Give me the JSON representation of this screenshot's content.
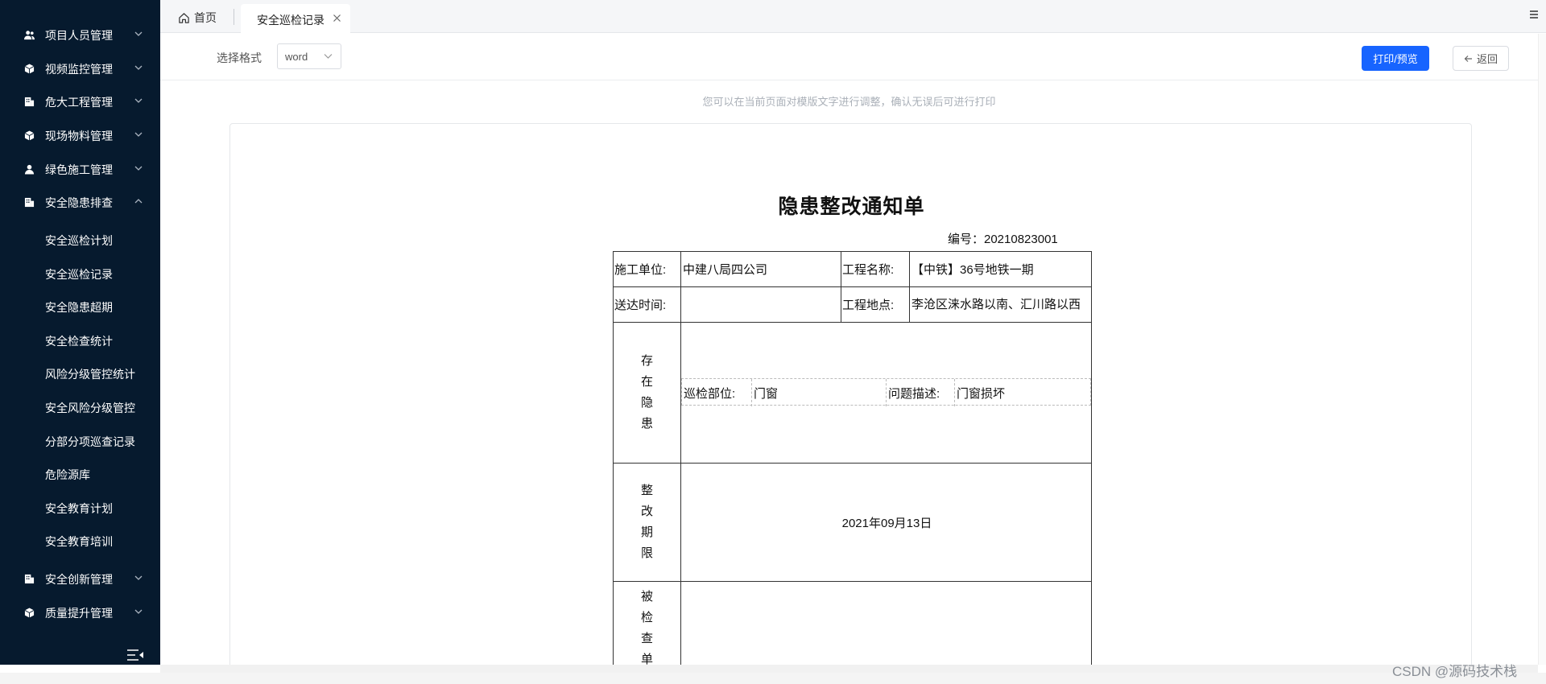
{
  "sidebar": {
    "menus": [
      {
        "label": "项目人员管理",
        "icon": "users-icon",
        "expanded": false
      },
      {
        "label": "视频监控管理",
        "icon": "cube-icon",
        "expanded": false
      },
      {
        "label": "危大工程管理",
        "icon": "building-icon",
        "expanded": false
      },
      {
        "label": "现场物料管理",
        "icon": "cube-icon",
        "expanded": false
      },
      {
        "label": "绿色施工管理",
        "icon": "user-icon",
        "expanded": false
      },
      {
        "label": "安全隐患排查",
        "icon": "building-icon",
        "expanded": true
      },
      {
        "label": "安全创新管理",
        "icon": "building-icon",
        "expanded": false
      },
      {
        "label": "质量提升管理",
        "icon": "cube-icon",
        "expanded": false
      }
    ],
    "submenu": [
      "安全巡检计划",
      "安全巡检记录",
      "安全隐患超期",
      "安全检查统计",
      "风险分级管控统计",
      "安全风险分级管控",
      "分部分项巡查记录",
      "危险源库",
      "安全教育计划",
      "安全教育培训"
    ]
  },
  "tabs": {
    "home": "首页",
    "active": "安全巡检记录"
  },
  "toolbar": {
    "format_label": "选择格式",
    "format_value": "word",
    "print_label": "打印/预览",
    "back_label": "返回"
  },
  "hint": "您可以在当前页面对模版文字进行调整，确认无误后可进行打印",
  "document": {
    "title": "隐患整改通知单",
    "number": "编号：20210823001",
    "construction_unit_label": "施工单位:",
    "construction_unit": "中建八局四公司",
    "project_name_label": "工程名称:",
    "project_name": "【中铁】36号地铁一期",
    "delivery_time_label": "送达时间:",
    "delivery_time": "",
    "project_location_label": "工程地点:",
    "project_location": "李沧区涞水路以南、汇川路以西",
    "hazard_label": [
      "存",
      "在",
      "隐",
      "患"
    ],
    "inspection_part_label": "巡检部位:",
    "inspection_part": "门窗",
    "problem_label": "问题描述:",
    "problem": "门窗损坏",
    "deadline_label": [
      "整",
      "改",
      "期",
      "限"
    ],
    "deadline": "2021年09月13日",
    "inspected_unit_label": [
      "被",
      "检",
      "查",
      "单"
    ]
  },
  "watermark": "CSDN @源码技术栈",
  "colors": {
    "sidebar_bg": "#061a2e",
    "primary": "#1764ff"
  }
}
